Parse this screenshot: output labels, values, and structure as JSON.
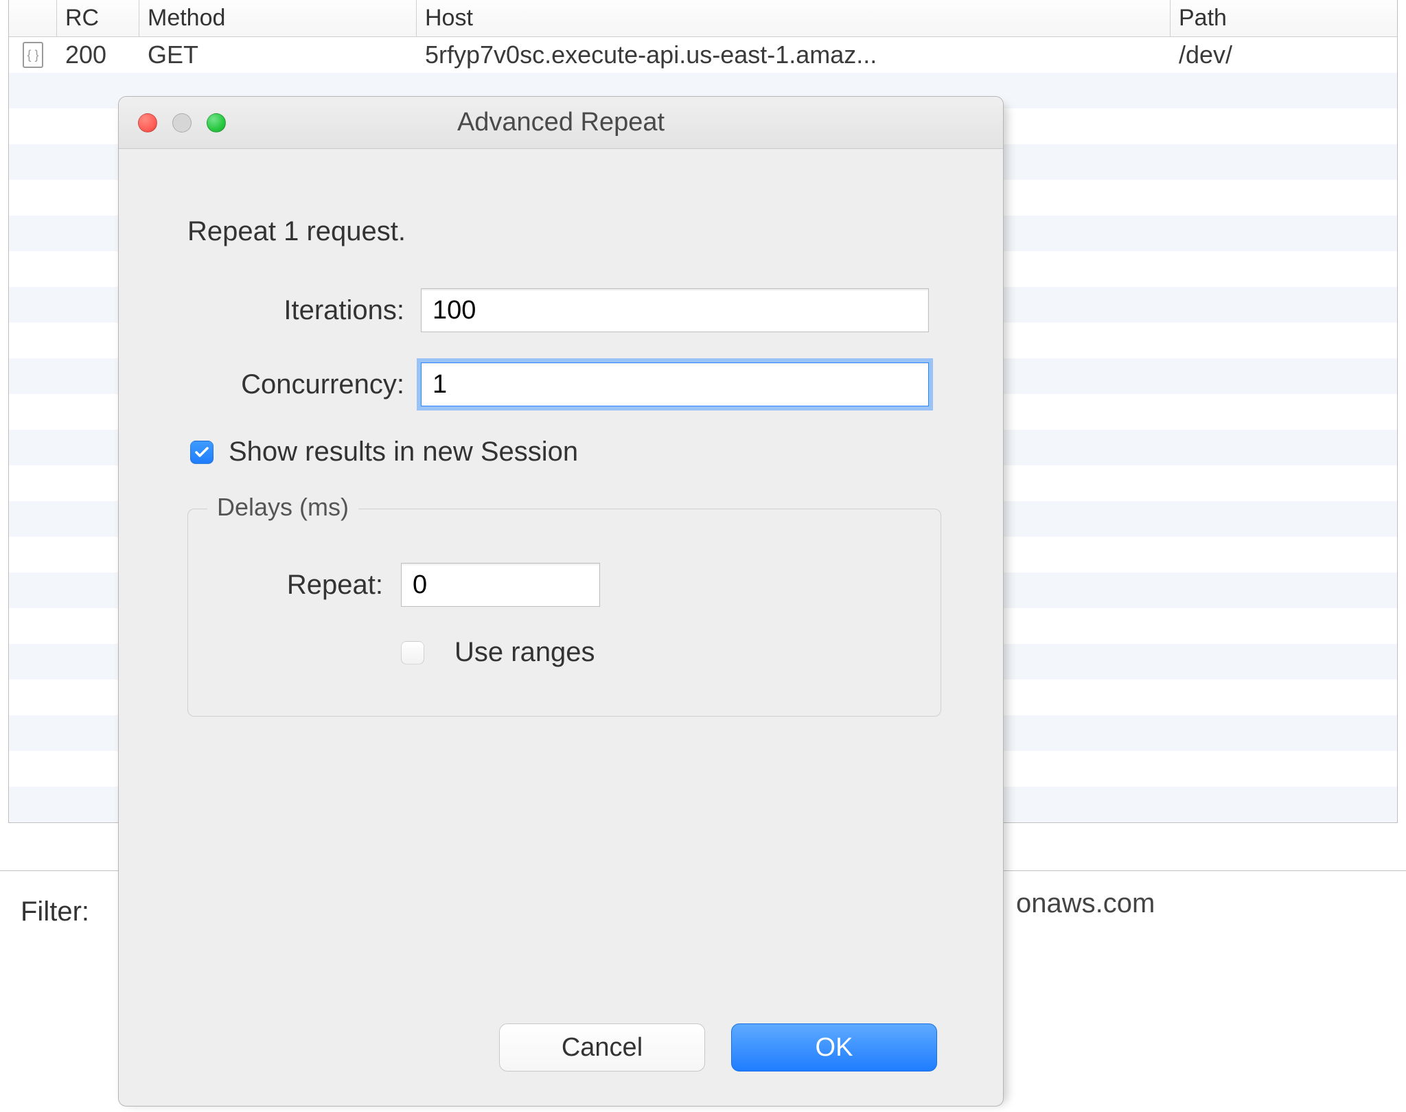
{
  "table": {
    "headers": {
      "rc": "RC",
      "method": "Method",
      "host": "Host",
      "path": "Path"
    },
    "row": {
      "rc": "200",
      "method": "GET",
      "host": "5rfyp7v0sc.execute-api.us-east-1.amaz...",
      "path": "/dev/"
    }
  },
  "filter": {
    "label": "Filter:",
    "value_fragment": "onaws.com"
  },
  "dialog": {
    "title": "Advanced Repeat",
    "subtitle": "Repeat 1 request.",
    "iterations_label": "Iterations:",
    "iterations_value": "100",
    "concurrency_label": "Concurrency:",
    "concurrency_value": "1",
    "show_results_label": "Show results in new Session",
    "show_results_checked": true,
    "delays": {
      "legend": "Delays (ms)",
      "repeat_label": "Repeat:",
      "repeat_value": "0",
      "use_ranges_label": "Use ranges",
      "use_ranges_checked": false
    },
    "buttons": {
      "cancel": "Cancel",
      "ok": "OK"
    }
  },
  "icons": {
    "file": "file-icon",
    "close": "close-traffic-light",
    "minimize": "minimize-traffic-light",
    "maximize": "maximize-traffic-light"
  }
}
